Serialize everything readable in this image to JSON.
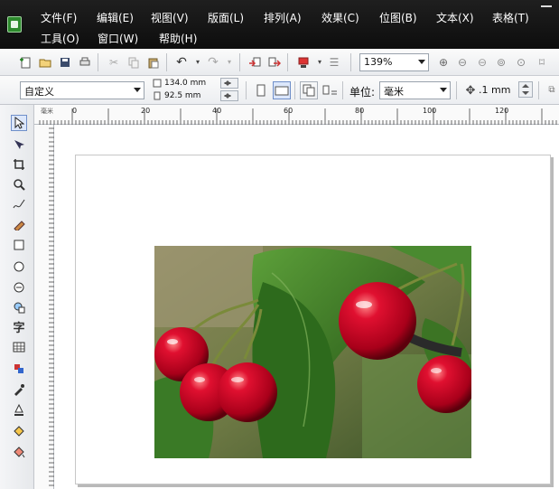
{
  "menu": {
    "row1": [
      "文件(F)",
      "编辑(E)",
      "视图(V)",
      "版面(L)",
      "排列(A)",
      "效果(C)",
      "位图(B)",
      "文本(X)",
      "表格(T)"
    ],
    "row2": [
      "工具(O)",
      "窗口(W)",
      "帮助(H)"
    ]
  },
  "toolbar": {
    "zoom": "139%",
    "icons": [
      "new-icon",
      "open-icon",
      "save-icon",
      "print-icon",
      "cut-icon",
      "copy-icon",
      "paste-icon",
      "undo-icon",
      "redo-icon",
      "import-icon",
      "export-icon",
      "app-launcher-icon",
      "zoom-in-icon",
      "zoom-out-icon",
      "zoom-page-icon",
      "zoom-width-icon"
    ]
  },
  "propertybar": {
    "page_preset": "自定义",
    "width": "134.0 mm",
    "height": "92.5 mm",
    "unit_label": "单位:",
    "unit_value": "毫米",
    "nudge": ".1 mm"
  },
  "rulers": {
    "top_unit": "毫米",
    "top_labels": [
      "0",
      "20",
      "40",
      "60",
      "80",
      "100",
      "120"
    ]
  },
  "toolbox": {
    "tools": [
      "pick-tool-icon",
      "shape-tool-icon",
      "crop-tool-icon",
      "zoom-tool-icon",
      "freehand-tool-icon",
      "smart-fill-tool-icon",
      "rectangle-tool-icon",
      "ellipse-tool-icon",
      "polygon-tool-icon",
      "basic-shapes-tool-icon",
      "text-tool-icon",
      "table-tool-icon",
      "interactive-tool-icon",
      "eyedropper-tool-icon",
      "outline-tool-icon",
      "fill-tool-icon",
      "interactive-fill-tool-icon"
    ],
    "text_tool_glyph": "字"
  },
  "colors": {
    "menubar": "#111111",
    "cherry": "#c8102e",
    "leaf": "#2f6b1f"
  },
  "canvas": {
    "image": "cherries-photo"
  }
}
